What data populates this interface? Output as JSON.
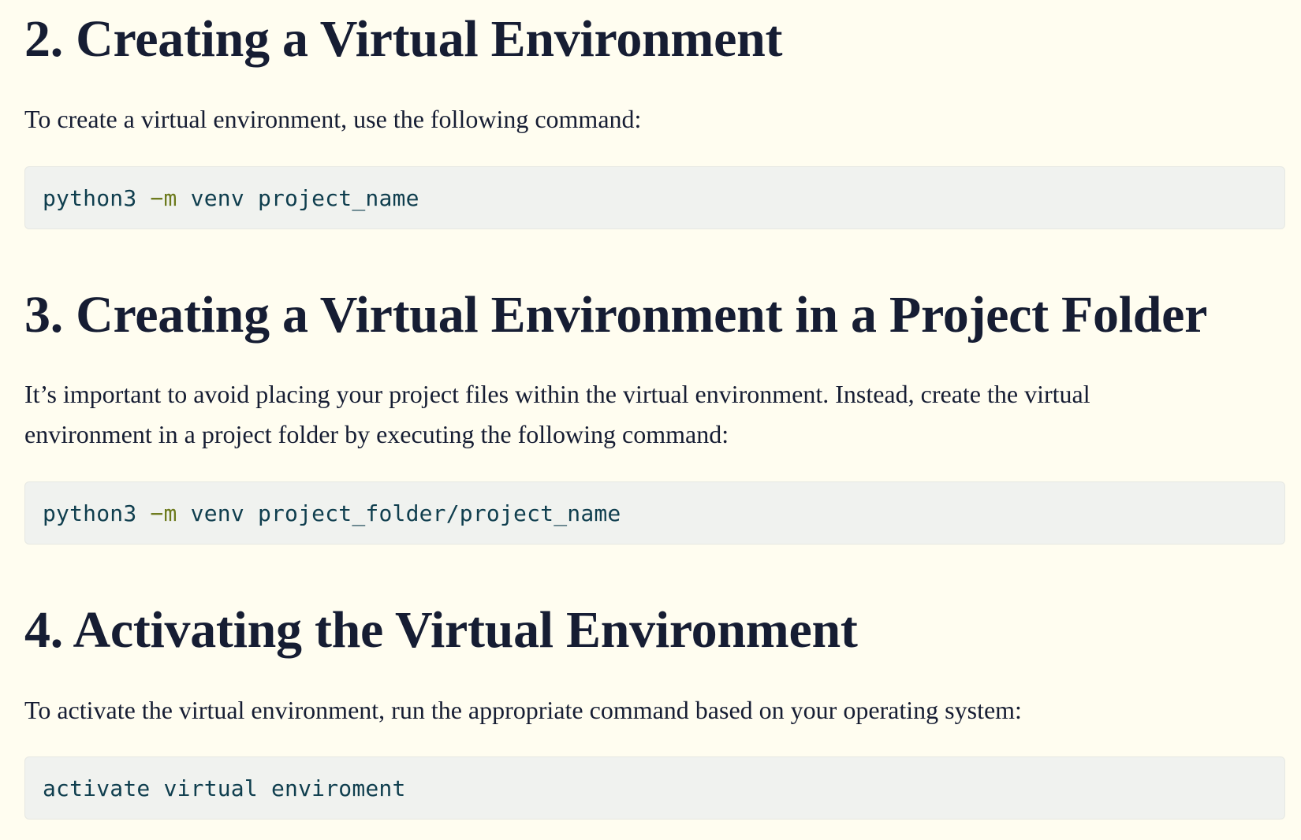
{
  "sections": [
    {
      "heading": "2. Creating a Virtual Environment",
      "text": "To create a virtual environment, use the following command:",
      "code": {
        "cmd": "python3 ",
        "flag": "−m",
        "rest": " venv project_name"
      }
    },
    {
      "heading": "3. Creating a Virtual Environment in a Project Folder",
      "text": "It’s important to avoid placing your project files within the virtual environment. Instead, create the virtual environment in a project folder by executing the following command:",
      "code": {
        "cmd": "python3 ",
        "flag": "−m",
        "rest": " venv project_folder/project_name"
      }
    },
    {
      "heading": "4. Activating the Virtual Environment",
      "text": "To activate the virtual environment, run the appropriate command based on your operating system:",
      "code": {
        "cmd": "activate virtual enviroment",
        "flag": "",
        "rest": ""
      }
    }
  ],
  "colors": {
    "background": "#fffdf0",
    "heading": "#161d33",
    "code_background": "#f0f2ef",
    "code_text": "#0f3e4e",
    "code_flag": "#6c7a1c"
  }
}
